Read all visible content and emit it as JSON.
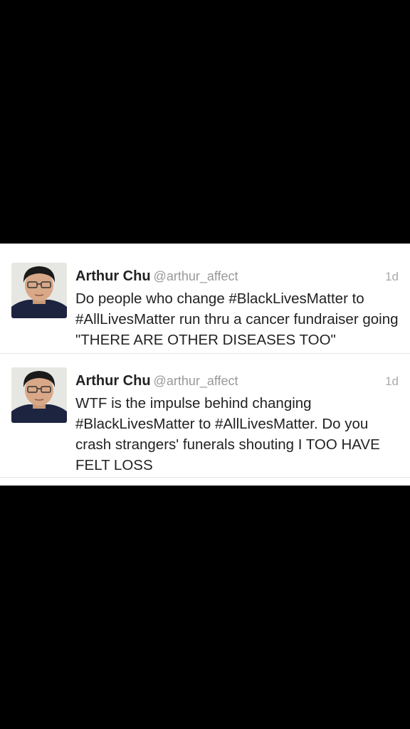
{
  "tweets": [
    {
      "name": "Arthur Chu",
      "handle": "@arthur_affect",
      "time": "1d",
      "text": "Do people who change #BlackLivesMatter to #AllLivesMatter run thru a cancer fundraiser going \"THERE ARE OTHER DISEASES TOO\""
    },
    {
      "name": "Arthur Chu",
      "handle": "@arthur_affect",
      "time": "1d",
      "text": "WTF is the impulse behind changing #BlackLivesMatter to #AllLivesMatter. Do you crash strangers' funerals shouting I TOO HAVE FELT LOSS"
    }
  ],
  "colors": {
    "background": "#000000",
    "card": "#ffffff",
    "name": "#222222",
    "handle": "#999999",
    "time": "#aaaaaa"
  },
  "icons": [
    "avatar-photo"
  ]
}
